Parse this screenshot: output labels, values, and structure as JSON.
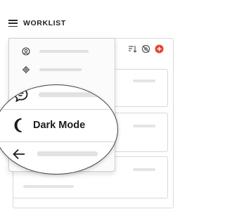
{
  "header": {
    "menu_icon": "hamburger-icon",
    "title": "WORKLIST"
  },
  "toolbar": {
    "icons": [
      "sort-icon",
      "no-view-icon",
      "add-icon"
    ],
    "accent": "#e8432c"
  },
  "menu": {
    "items": [
      {
        "icon": "account-icon"
      },
      {
        "icon": "gear-icon"
      },
      {
        "icon": "chat-icon"
      },
      {
        "icon": "moon-icon",
        "label": "Dark Mode"
      },
      {
        "icon": "arrow-left-icon"
      }
    ]
  }
}
